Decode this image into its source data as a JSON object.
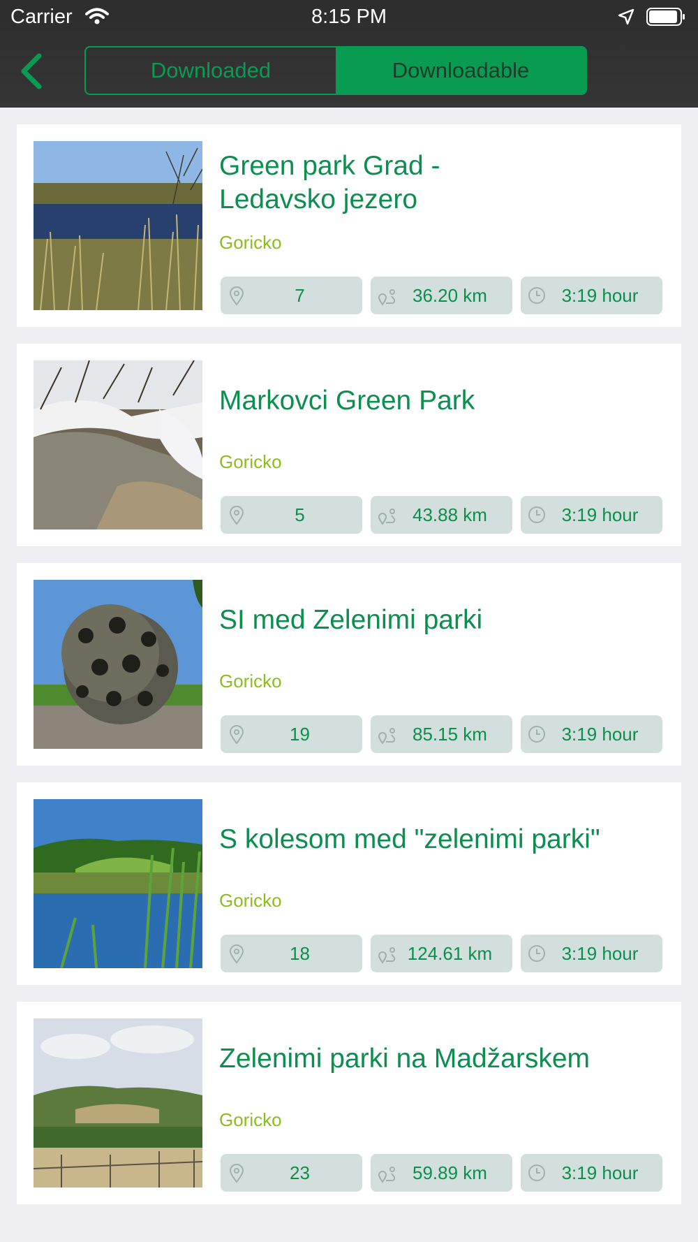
{
  "status": {
    "carrier": "Carrier",
    "time": "8:15 PM"
  },
  "tabs": {
    "downloaded": "Downloaded",
    "downloadable": "Downloadable"
  },
  "routes": [
    {
      "title_line1": "Green park Grad -",
      "title_line2": "Ledavsko jezero",
      "region": "Goricko",
      "points": "7",
      "distance": "36.20 km",
      "duration": "3:19 hour"
    },
    {
      "title": "Markovci Green Park",
      "region": "Goricko",
      "points": "5",
      "distance": "43.88 km",
      "duration": "3:19 hour"
    },
    {
      "title": "SI med Zelenimi parki",
      "region": "Goricko",
      "points": "19",
      "distance": "85.15 km",
      "duration": "3:19 hour"
    },
    {
      "title": "S kolesom med \"zelenimi parki\"",
      "region": "Goricko",
      "points": "18",
      "distance": "124.61 km",
      "duration": "3:19 hour"
    },
    {
      "title": "Zelenimi parki na Madžarskem",
      "region": "Goricko",
      "points": "23",
      "distance": "59.89 km",
      "duration": "3:19 hour"
    }
  ],
  "colors": {
    "accent": "#0a9b52",
    "region": "#8cbd1f",
    "pill": "#d3dfdd",
    "bar": "#333333"
  }
}
